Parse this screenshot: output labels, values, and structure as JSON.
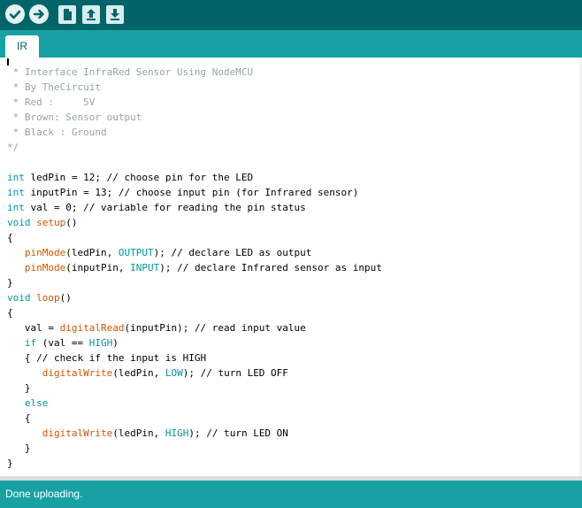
{
  "toolbar": {
    "buttons": [
      {
        "name": "verify",
        "icon": "check-icon"
      },
      {
        "name": "upload",
        "icon": "arrow-right-icon"
      },
      {
        "name": "new",
        "icon": "new-file-icon"
      },
      {
        "name": "open",
        "icon": "arrow-up-icon"
      },
      {
        "name": "save",
        "icon": "arrow-down-icon"
      }
    ]
  },
  "tabs": [
    {
      "label": "IR"
    }
  ],
  "editor": {
    "lines": [
      " * Interface InfraRed Sensor Using NodeMCU",
      " * By TheCircuit",
      " * Red :     5V",
      " * Brown: Sensor output",
      " * Black : Ground",
      "*/",
      "",
      "int ledPin = 12; // choose pin for the LED",
      "int inputPin = 13; // choose input pin (for Infrared sensor)",
      "int val = 0; // variable for reading the pin status",
      "void setup()",
      "{",
      "   pinMode(ledPin, OUTPUT); // declare LED as output",
      "   pinMode(inputPin, INPUT); // declare Infrared sensor as input",
      "}",
      "void loop()",
      "{",
      "   val = digitalRead(inputPin); // read input value",
      "   if (val == HIGH)",
      "   { // check if the input is HIGH",
      "      digitalWrite(ledPin, LOW); // turn LED OFF",
      "   }",
      "   else",
      "   {",
      "      digitalWrite(ledPin, HIGH); // turn LED ON",
      "   }",
      "}"
    ]
  },
  "status": {
    "message": "Done uploading."
  },
  "colors": {
    "toolbar": "#006468",
    "tabbar": "#17a1a5",
    "keyword": "#00979c",
    "function": "#d35400",
    "comment": "#95a5a6"
  }
}
